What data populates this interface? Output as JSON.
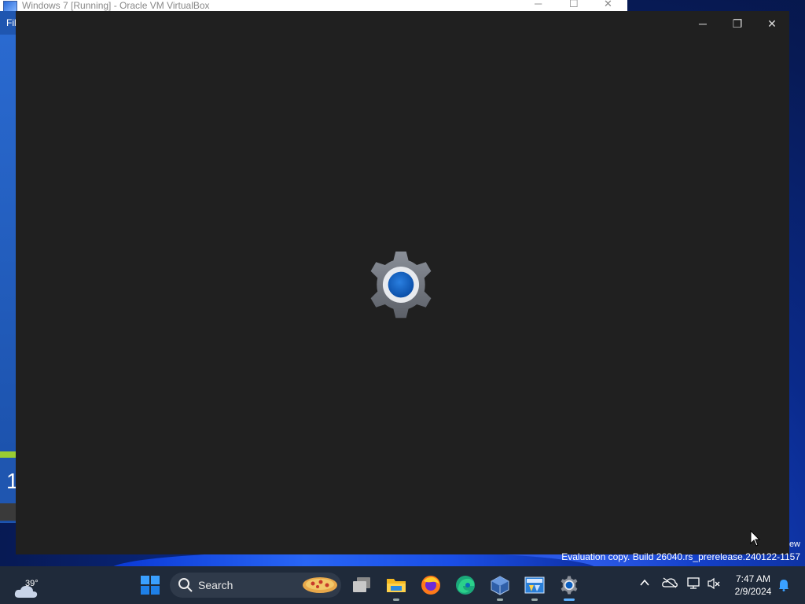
{
  "background_window": {
    "title": "Windows 7 [Running] - Oracle VM VirtualBox",
    "menu_first": "File",
    "partial_text": "1"
  },
  "settings_window": {
    "icon": "settings-gear-icon",
    "controls": {
      "minimize": "─",
      "restore": "❐",
      "close": "✕"
    }
  },
  "watermark": {
    "line1": "ew",
    "line2": "Evaluation copy. Build 26040.rs_prerelease.240122-1157"
  },
  "taskbar": {
    "weather_temp": "39°",
    "search_label": "Search",
    "apps": [
      {
        "name": "start-icon"
      },
      {
        "name": "task-view-icon"
      },
      {
        "name": "file-explorer-icon"
      },
      {
        "name": "firefox-icon"
      },
      {
        "name": "edge-icon"
      },
      {
        "name": "virtualbox-icon"
      },
      {
        "name": "virtualbox-vm-icon"
      },
      {
        "name": "settings-icon"
      }
    ],
    "time": "7:47 AM",
    "date": "2/9/2024"
  },
  "colors": {
    "settings_bg": "#202020",
    "taskbar_bg": "#1f2a3a",
    "accent": "#0067c0"
  }
}
